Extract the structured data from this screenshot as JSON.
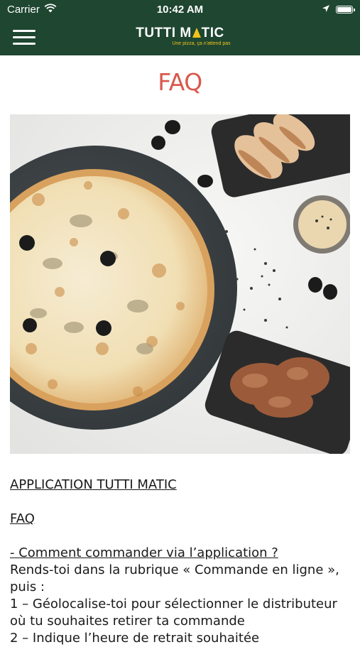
{
  "status_bar": {
    "carrier": "Carrier",
    "time": "10:42 AM",
    "icons": [
      "wifi-icon",
      "location-arrow-icon",
      "battery-icon"
    ]
  },
  "nav": {
    "menu_icon": "hamburger-menu-icon",
    "logo": {
      "title_part1": "TUTTI M",
      "title_part2": "TIC",
      "tagline": "Une pizza, ça n'attend pas"
    },
    "colors": {
      "bar": "#1e4631",
      "accent": "#f2c31b"
    }
  },
  "page": {
    "title": "FAQ",
    "title_color": "#d9584d"
  },
  "content": {
    "heading_app": "APPLICATION TUTTI MATIC",
    "heading_faq": "FAQ",
    "question_1": "- Comment commander via l’application ?",
    "line_1": "Rends-toi dans la rubrique « Commande en ligne », puis :",
    "step_1": "1 – Géolocalise-toi pour sélectionner le distributeur où tu souhaites retirer ta commande",
    "step_2": "2 – Indique l’heure de retrait souhaitée"
  }
}
